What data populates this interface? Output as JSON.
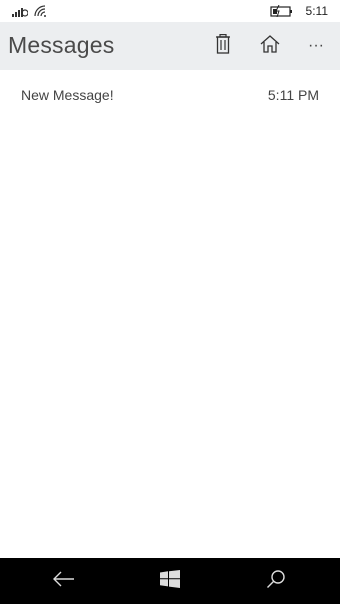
{
  "status_bar": {
    "time": "5:11",
    "icons": [
      "signal-icon",
      "wifi-icon",
      "battery-charging-icon"
    ]
  },
  "app_bar": {
    "title": "Messages",
    "actions": [
      "delete-icon",
      "home-icon",
      "more-icon"
    ],
    "more_label": "···"
  },
  "messages": [
    {
      "subject": "New Message!",
      "time": "5:11 PM"
    }
  ],
  "nav_bar": {
    "buttons": [
      "back-icon",
      "windows-start-icon",
      "search-icon"
    ]
  },
  "colors": {
    "app_bar_bg": "#eceef0",
    "nav_bar_bg": "#000000",
    "text": "#444444"
  }
}
